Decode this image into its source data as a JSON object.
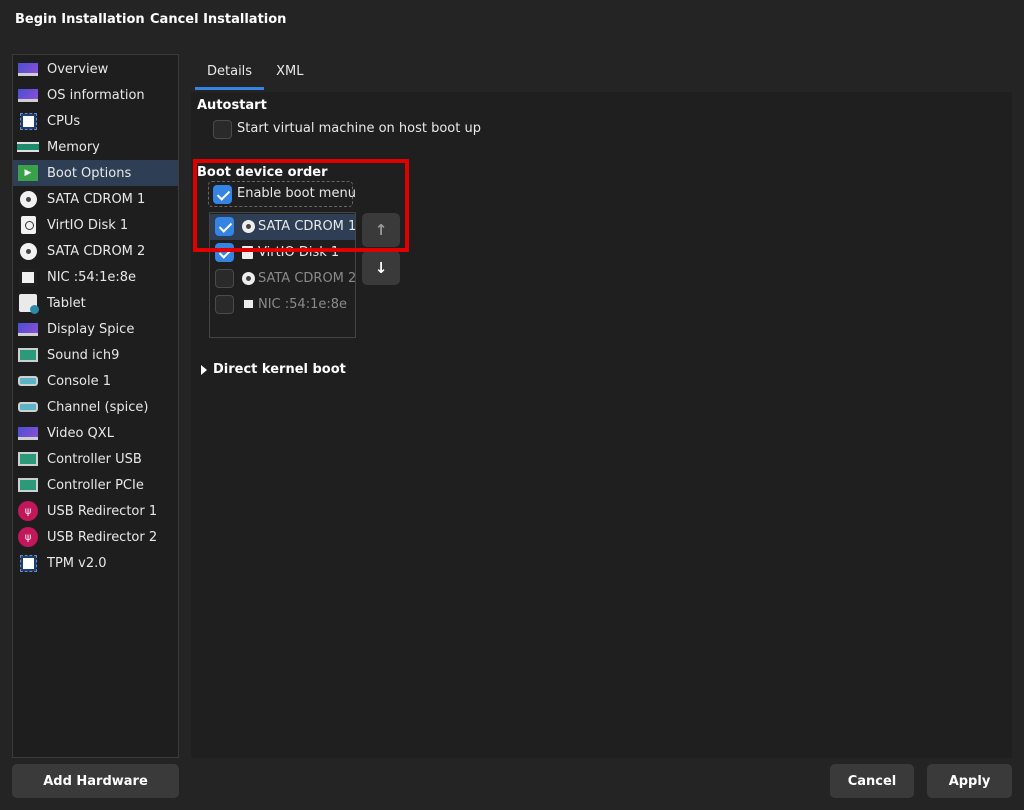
{
  "toolbar": {
    "begin_label": "Begin Installation",
    "cancel_label": "Cancel Installation"
  },
  "sidebar": {
    "selected_index": 4,
    "items": [
      {
        "label": "Overview",
        "icon": "monitor-icon"
      },
      {
        "label": "OS information",
        "icon": "monitor-icon"
      },
      {
        "label": "CPUs",
        "icon": "cpu-icon"
      },
      {
        "label": "Memory",
        "icon": "memory-icon"
      },
      {
        "label": "Boot Options",
        "icon": "boot-icon"
      },
      {
        "label": "SATA CDROM 1",
        "icon": "cdrom-icon"
      },
      {
        "label": "VirtIO Disk 1",
        "icon": "disk-icon"
      },
      {
        "label": "SATA CDROM 2",
        "icon": "cdrom-icon"
      },
      {
        "label": "NIC :54:1e:8e",
        "icon": "network-icon"
      },
      {
        "label": "Tablet",
        "icon": "tablet-icon"
      },
      {
        "label": "Display Spice",
        "icon": "display-icon"
      },
      {
        "label": "Sound ich9",
        "icon": "sound-card-icon"
      },
      {
        "label": "Console 1",
        "icon": "serial-icon"
      },
      {
        "label": "Channel (spice)",
        "icon": "serial-icon"
      },
      {
        "label": "Video QXL",
        "icon": "display-icon"
      },
      {
        "label": "Controller USB",
        "icon": "controller-icon"
      },
      {
        "label": "Controller PCIe",
        "icon": "controller-icon"
      },
      {
        "label": "USB Redirector 1",
        "icon": "usb-icon"
      },
      {
        "label": "USB Redirector 2",
        "icon": "usb-icon"
      },
      {
        "label": "TPM v2.0",
        "icon": "tpm-icon"
      }
    ],
    "add_hardware_label": "Add Hardware"
  },
  "tabs": [
    {
      "label": "Details",
      "active": true
    },
    {
      "label": "XML",
      "active": false
    }
  ],
  "autostart": {
    "title": "Autostart",
    "checkbox_label": "Start virtual machine on host boot up",
    "checked": false
  },
  "boot": {
    "title": "Boot device order",
    "enable_menu_label": "Enable boot menu",
    "enable_menu_checked": true,
    "devices": [
      {
        "label": "SATA CDROM 1",
        "checked": true,
        "icon": "cdrom-icon",
        "selected": true
      },
      {
        "label": "VirtIO Disk 1",
        "checked": true,
        "icon": "disk-icon",
        "selected": false
      },
      {
        "label": "SATA CDROM 2",
        "checked": false,
        "icon": "cdrom-icon",
        "selected": false
      },
      {
        "label": "NIC :54:1e:8e",
        "checked": false,
        "icon": "network-icon",
        "selected": false
      }
    ],
    "up_arrow": "↑",
    "down_arrow": "↓"
  },
  "direct_kernel_boot": {
    "label": "Direct kernel boot",
    "expanded": false
  },
  "footer": {
    "cancel_label": "Cancel",
    "apply_label": "Apply"
  },
  "colors": {
    "accent": "#3584e4",
    "selection": "#2d3e55",
    "highlight_box": "#e00000"
  }
}
